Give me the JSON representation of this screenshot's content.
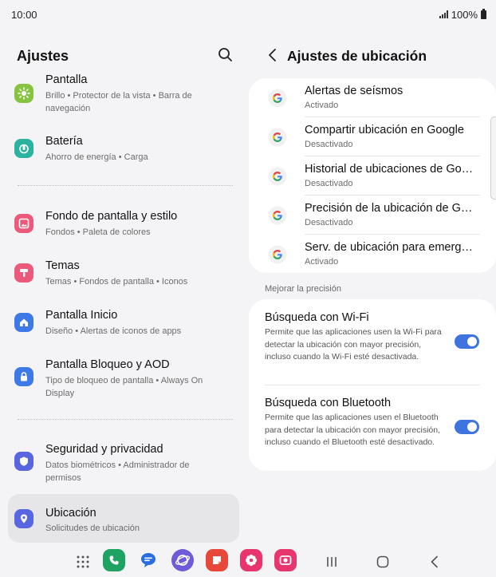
{
  "status": {
    "time": "10:00",
    "battery": "100%"
  },
  "left": {
    "title": "Ajustes",
    "items": [
      {
        "title": "Pantalla",
        "subtitle": "Brillo • Protector de la vista • Barra de navegación",
        "icon": "sun-icon",
        "color": "#86c341"
      },
      {
        "title": "Batería",
        "subtitle": "Ahorro de energía • Carga",
        "icon": "battery-icon",
        "color": "#2bb39f"
      },
      {
        "title": "Fondo de pantalla y estilo",
        "subtitle": "Fondos • Paleta de colores",
        "icon": "image-icon",
        "color": "#ec5a7b"
      },
      {
        "title": "Temas",
        "subtitle": "Temas • Fondos de pantalla • Iconos",
        "icon": "brush-icon",
        "color": "#ec5a7b"
      },
      {
        "title": "Pantalla Inicio",
        "subtitle": "Diseño • Alertas de iconos de apps",
        "icon": "home-icon",
        "color": "#3d7ae8"
      },
      {
        "title": "Pantalla Bloqueo y AOD",
        "subtitle": "Tipo de bloqueo de pantalla • Always On Display",
        "icon": "lock-icon",
        "color": "#3d7ae8"
      },
      {
        "title": "Seguridad y privacidad",
        "subtitle": "Datos biométricos • Administrador de permisos",
        "icon": "shield-icon",
        "color": "#5866e0"
      },
      {
        "title": "Ubicación",
        "subtitle": "Solicitudes de ubicación",
        "icon": "location-pin-icon",
        "color": "#5866e0"
      }
    ]
  },
  "right": {
    "title": "Ajustes de ubicación",
    "services": [
      {
        "title": "Alertas de seísmos",
        "status": "Activado"
      },
      {
        "title": "Compartir ubicación en Google",
        "status": "Desactivado"
      },
      {
        "title": "Historial de ubicaciones de Google",
        "status": "Desactivado"
      },
      {
        "title": "Precisión de la ubicación de Google",
        "status": "Desactivado"
      },
      {
        "title": "Serv. de ubicación para emergencias",
        "status": "Activado"
      }
    ],
    "section_label": "Mejorar la precisión",
    "toggles": [
      {
        "title": "Búsqueda con Wi-Fi",
        "description": "Permite que las aplicaciones usen la Wi-Fi para detectar la ubicación con mayor precisión, incluso cuando la Wi-Fi esté desactivada.",
        "on": true
      },
      {
        "title": "Búsqueda con Bluetooth",
        "description": "Permite que las aplicaciones usen el Bluetooth para detectar la ubicación con mayor precisión, incluso cuando el Bluetooth esté desactivado.",
        "on": true
      }
    ]
  },
  "nav": {
    "apps": [
      {
        "icon": "phone-icon",
        "color": "#1ea362"
      },
      {
        "icon": "messages-icon",
        "color": "#2a6de0"
      },
      {
        "icon": "internet-icon",
        "color": "#6f5bd8"
      },
      {
        "icon": "notes-icon",
        "color": "#e8483a"
      },
      {
        "icon": "gallery-icon",
        "color": "#e8356d"
      },
      {
        "icon": "camera-icon",
        "color": "#e8356d"
      }
    ]
  }
}
